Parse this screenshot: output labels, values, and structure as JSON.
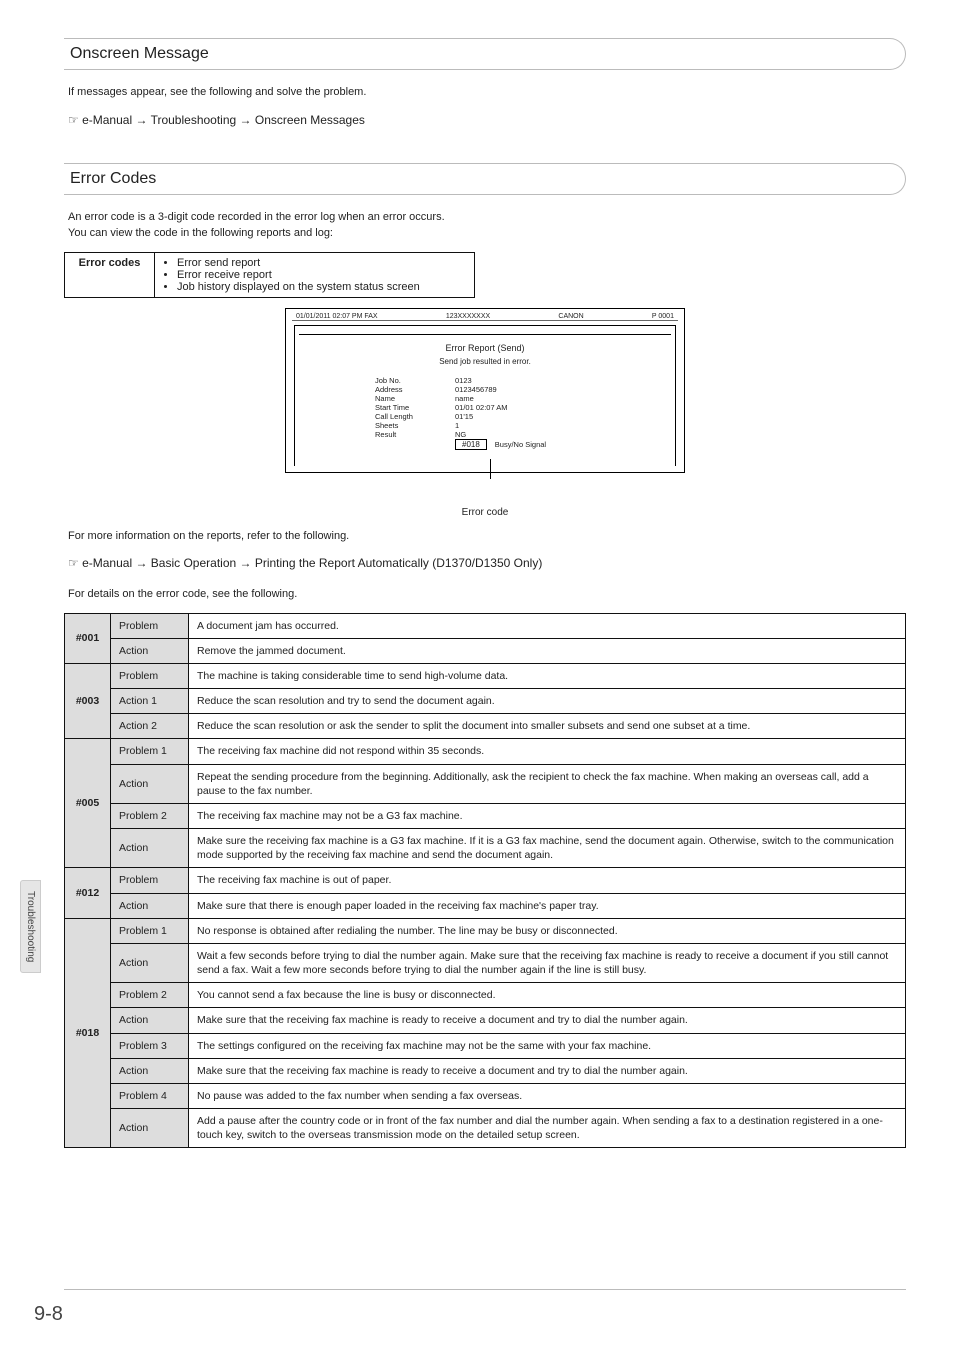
{
  "sections": {
    "onscreen": {
      "title": "Onscreen Message",
      "intro": "If messages appear, see the following and solve the problem.",
      "breadcrumb_prefix": "☞ e-Manual →",
      "breadcrumb_rest": "Troubleshooting → Onscreen Messages"
    },
    "errorcodes": {
      "title": "Error Codes",
      "intro": "An error code is a 3-digit code recorded in the error log when an error occurs.\nYou can view the code in the following reports and log:",
      "box_label": "Error codes",
      "box_items": [
        "Error send report",
        "Error receive report",
        "Job history displayed on the system status screen"
      ],
      "after_figure_1": "For more information on the reports, refer to the following.",
      "after_crumb_prefix": "☞ e-Manual →",
      "after_crumb_rest": "Basic Operation → Printing the Report Automatically (D1370/D1350 Only)",
      "after_figure_2": "For details on the error code, see the following."
    }
  },
  "report": {
    "top_left": "01/01/2011 02:07 PM FAX",
    "top_mid": "123XXXXXXX",
    "top_right_a": "CANON",
    "top_right_b": "P 0001",
    "title": "Error Report (Send)",
    "subtitle": "Send job resulted in error.",
    "fields": [
      {
        "k": "Job No.",
        "v": "0123"
      },
      {
        "k": "Address",
        "v": "0123456789"
      },
      {
        "k": "Name",
        "v": "name"
      },
      {
        "k": "Start Time",
        "v": "01/01 02:07 AM"
      },
      {
        "k": "Call Length",
        "v": "01'15"
      },
      {
        "k": "Sheets",
        "v": "1"
      }
    ],
    "result_label": "Result",
    "result_value": "NG",
    "result_code": "#018",
    "result_reason": "Busy/No Signal",
    "caption": "Error code"
  },
  "table": [
    {
      "code": "#001",
      "rows": [
        {
          "key": "Problem",
          "val": "A document jam has occurred."
        },
        {
          "key": "Action",
          "val": "Remove the jammed document."
        }
      ]
    },
    {
      "code": "#003",
      "rows": [
        {
          "key": "Problem",
          "val": "The machine is taking considerable time to send high-volume data."
        },
        {
          "key": "Action 1",
          "val": "Reduce the scan resolution and try to send the document again."
        },
        {
          "key": "Action 2",
          "val": "Reduce the scan resolution or ask the sender to split the document into smaller subsets and send one subset at a time."
        }
      ]
    },
    {
      "code": "#005",
      "rows": [
        {
          "key": "Problem 1",
          "val": "The receiving fax machine did not respond within 35 seconds."
        },
        {
          "key": "Action",
          "val": "Repeat the sending procedure from the beginning. Additionally, ask the recipient to check the fax machine. When making an overseas call, add a pause to the fax number."
        },
        {
          "key": "Problem 2",
          "val": "The receiving fax machine may not be a G3 fax machine."
        },
        {
          "key": "Action",
          "val": "Make sure the receiving fax machine is a G3 fax machine. If it is a G3 fax machine, send the document again. Otherwise, switch to the communication mode supported by the receiving fax machine and send the document again."
        }
      ]
    },
    {
      "code": "#012",
      "rows": [
        {
          "key": "Problem",
          "val": "The receiving fax machine is out of paper."
        },
        {
          "key": "Action",
          "val": "Make sure that there is enough paper loaded in the receiving fax machine's paper tray."
        }
      ]
    },
    {
      "code": "#018",
      "rows": [
        {
          "key": "Problem 1",
          "val": "No response is obtained after redialing the number. The line may be busy or disconnected."
        },
        {
          "key": "Action",
          "val": "Wait a few seconds before trying to dial the number again. Make sure that the receiving fax machine is ready to receive a document if you still cannot send a fax. Wait a few more seconds before trying to dial the number again if the line is still busy."
        },
        {
          "key": "Problem 2",
          "val": "You cannot send a fax because the line is busy or disconnected."
        },
        {
          "key": "Action",
          "val": "Make sure that the receiving fax machine is ready to receive a document and try to dial the number again."
        },
        {
          "key": "Problem 3",
          "val": "The settings configured on the receiving fax machine may not be the same with your fax machine."
        },
        {
          "key": "Action",
          "val": "Make sure that the receiving fax machine is ready to receive a document and try to dial the number again."
        },
        {
          "key": "Problem 4",
          "val": "No pause was added to the fax number when sending a fax overseas."
        },
        {
          "key": "Action",
          "val": "Add a pause after the country code or in front of the fax number and dial the number again. When sending a fax to a destination registered in a one-touch key, switch to the overseas transmission mode on the detailed setup screen."
        }
      ]
    }
  ],
  "side_tab": "Troubleshooting",
  "page_number": "9-8"
}
